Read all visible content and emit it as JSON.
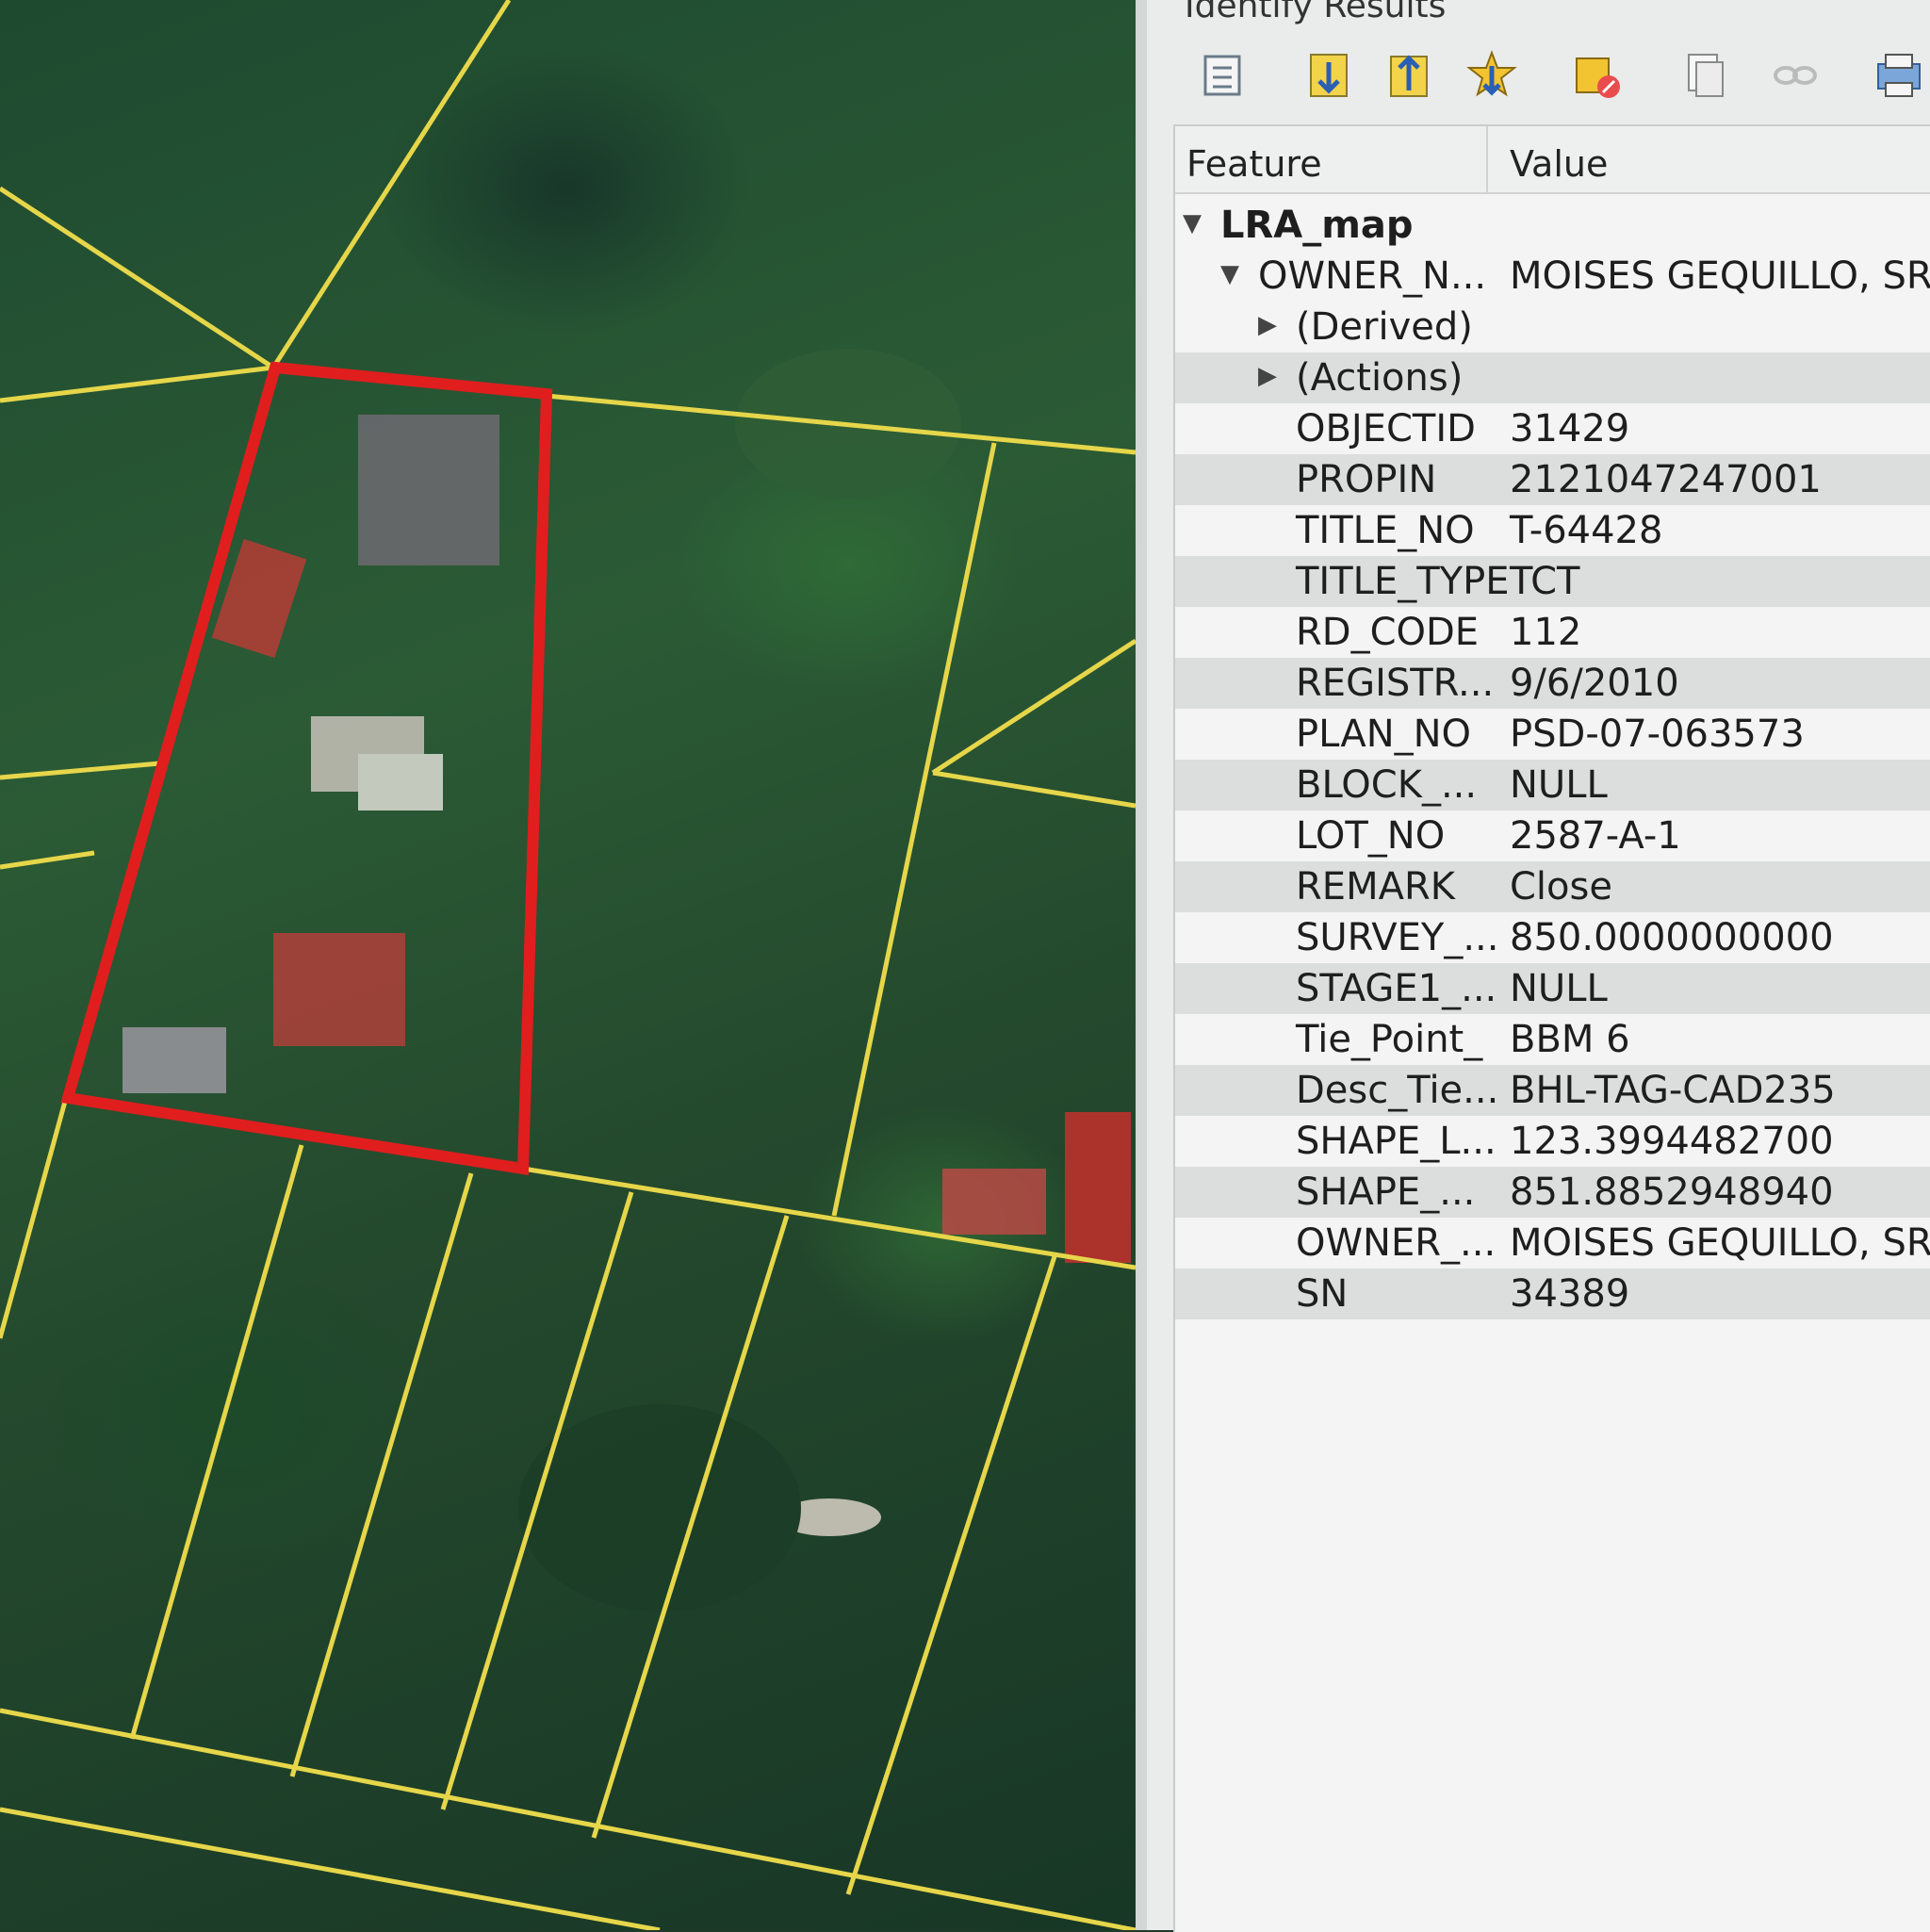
{
  "panel": {
    "title": "Identify Results",
    "columns": {
      "feature": "Feature",
      "value": "Value"
    },
    "toolbar_icons": [
      "expand-tree-icon",
      "collapse-tree-icon",
      "expand-new-features-icon",
      "highlight-icon",
      "clear-results-icon",
      "copy-icon",
      "link-icon",
      "print-icon"
    ],
    "tree": {
      "layer": "LRA_map",
      "feature_field": "OWNER_N...",
      "feature_value": "MOISES GEQUILLO, SR.",
      "groups": [
        "(Derived)",
        "(Actions)"
      ],
      "attributes": [
        {
          "name": "OBJECTID",
          "value": "31429"
        },
        {
          "name": "PROPIN",
          "value": "2121047247001"
        },
        {
          "name": "TITLE_NO",
          "value": "T-64428"
        },
        {
          "name": "TITLE_TYPE",
          "value": "TCT"
        },
        {
          "name": "RD_CODE",
          "value": "112"
        },
        {
          "name": "REGISTR...",
          "value": "9/6/2010"
        },
        {
          "name": "PLAN_NO",
          "value": "PSD-07-063573"
        },
        {
          "name": "BLOCK_...",
          "value": "NULL"
        },
        {
          "name": "LOT_NO",
          "value": "2587-A-1"
        },
        {
          "name": "REMARK",
          "value": "Close"
        },
        {
          "name": "SURVEY_...",
          "value": "850.0000000000"
        },
        {
          "name": "STAGE1_...",
          "value": "NULL"
        },
        {
          "name": "Tie_Point_",
          "value": "BBM 6"
        },
        {
          "name": "Desc_Tie...",
          "value": "BHL-TAG-CAD235"
        },
        {
          "name": "SHAPE_L...",
          "value": "123.3994482700"
        },
        {
          "name": "SHAPE_...",
          "value": "851.8852948940"
        },
        {
          "name": "OWNER_...",
          "value": "MOISES GEQUILLO, SR."
        },
        {
          "name": "SN",
          "value": "34389"
        }
      ]
    }
  },
  "colors": {
    "parcel_line": "#e6d64a",
    "selected_parcel": "#e01e1e",
    "panel_bg": "#e9eceb"
  }
}
